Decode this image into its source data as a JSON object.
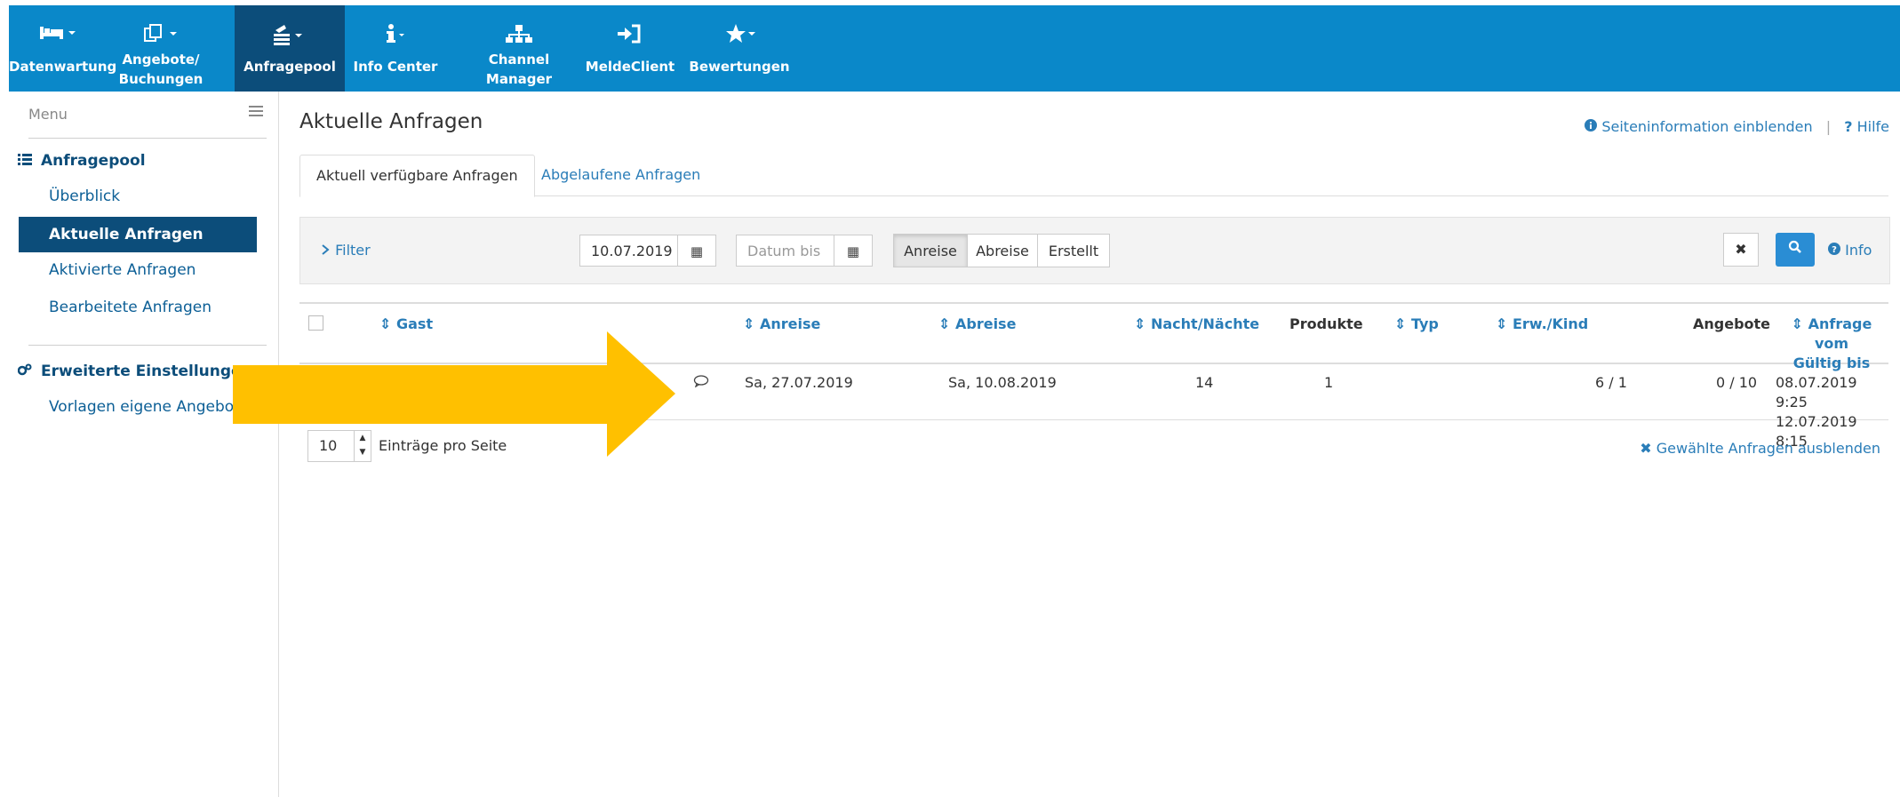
{
  "topnav": {
    "items": [
      {
        "label": "Datenwartung",
        "icon": "bed-icon"
      },
      {
        "label": "Angebote/ Buchungen",
        "line1": "Angebote/",
        "line2": "Buchungen",
        "icon": "copy-edit-icon"
      },
      {
        "label": "Anfragepool",
        "icon": "inbox-stack-icon",
        "active": true
      },
      {
        "label": "Info Center",
        "icon": "info-icon"
      },
      {
        "label": "Channel Manager",
        "line1": "Channel",
        "line2": "Manager",
        "icon": "sitemap-icon"
      },
      {
        "label": "MeldeClient",
        "icon": "sign-in-icon"
      },
      {
        "label": "Bewertungen",
        "icon": "star-icon"
      }
    ]
  },
  "sidebar": {
    "menu_label": "Menu",
    "section1": "Anfragepool",
    "links1": [
      "Überblick",
      "Aktuelle Anfragen",
      "Aktivierte Anfragen",
      "Bearbeitete Anfragen"
    ],
    "section2": "Erweiterte Einstellungen",
    "links2": [
      "Vorlagen eigene Angebote"
    ]
  },
  "main": {
    "title": "Aktuelle Anfragen",
    "page_info_link": "Seiteninformation einblenden",
    "help_link": "Hilfe",
    "tabs": [
      "Aktuell verfügbare Anfragen",
      "Abgelaufene Anfragen"
    ]
  },
  "filter": {
    "toggle_label": "Filter",
    "date_from": "10.07.2019",
    "date_to_placeholder": "Datum bis",
    "date_modes": [
      "Anreise",
      "Abreise",
      "Erstellt"
    ],
    "selected_mode": "Anreise",
    "info_label": "Info"
  },
  "table": {
    "headers": {
      "gast": "Gast",
      "anreise": "Anreise",
      "abreise": "Abreise",
      "naechte": "Nacht/Nächte",
      "produkte": "Produkte",
      "typ": "Typ",
      "erw_kind": "Erw./Kind",
      "angebote": "Angebote",
      "anfrage_vom": "Anfrage vom",
      "gueltig_bis": "Gültig bis"
    },
    "rows": [
      {
        "anreise": "Sa, 27.07.2019",
        "abreise": "Sa, 10.08.2019",
        "naechte": "14",
        "produkte": "1",
        "erw_kind": "6 / 1",
        "angebote": "0 / 10",
        "anfrage_vom": "08.07.2019 9:25",
        "gueltig_bis": "12.07.2019 8:15"
      }
    ]
  },
  "pager": {
    "page_size": "10",
    "label": "Einträge pro Seite"
  },
  "hide_selected": "Gewählte Anfragen ausblenden",
  "colors": {
    "nav_bg": "#0a88c9",
    "nav_active": "#0c4d7a",
    "link": "#2a7db8",
    "annotation_arrow": "#ffc000"
  }
}
